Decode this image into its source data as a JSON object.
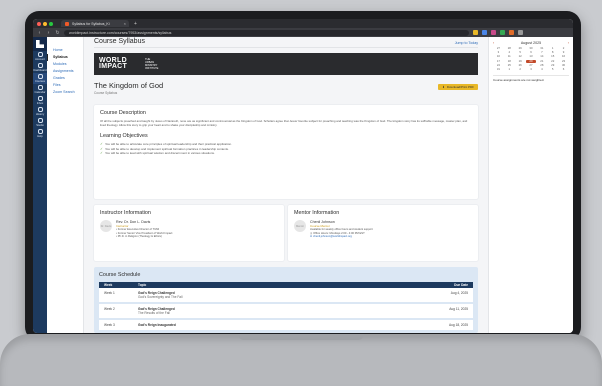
{
  "browser": {
    "tab_title": "Syllabus for Syllabus_Ki",
    "url": "worldimpact.instructure.com/courses/7953/assignments/syllabus"
  },
  "rail": [
    "Account",
    "Dashboard",
    "Courses",
    "Calendar",
    "Inbox",
    "History",
    "Studio",
    "Help"
  ],
  "course_nav": [
    "Home",
    "Syllabus",
    "Modules",
    "Assignments",
    "Grades",
    "Files",
    "Zoom Search"
  ],
  "header": {
    "title": "Course Syllabus",
    "student_view": "Jump to Today"
  },
  "banner": {
    "logo_line1": "WORLD",
    "logo_line2": "IMPACT",
    "sub1": "THE",
    "sub2": "URBAN",
    "sub3": "MINISTRY",
    "sub4": "INSTITUTE"
  },
  "course": {
    "title": "The Kingdom of God",
    "subtitle": "Course Syllabus",
    "pdf_button": "Download/Print PDF"
  },
  "description": {
    "heading": "Course Description",
    "text": "Of all the subjects preached and taught by Jesus of Nazareth, none are as significant and controversial as the Kingdom of God. Scholars agree that Jesus' favorite subject for preaching and teaching was the Kingdom of God. The kingdom story has its suffrable message, master plan, and lived theology. Allow this story to grip your heart and to shake your discipleship and ministry."
  },
  "objectives": {
    "heading": "Learning Objectives",
    "items": [
      "You will be able to articulate core principles of spiritual leadership and their practical application.",
      "You will be able to develop and implement spiritual formation practices in leadership contexts.",
      "You will be able to lead with spiritual wisdom and discernment in various situations."
    ]
  },
  "instructor": {
    "heading": "Instructor Information",
    "avatar": "Dr. Davis",
    "name": "Rev. Dr. Don L. Davis",
    "role": "Instructor",
    "bullets": [
      "Former Executive Director of TUMI",
      "Former Senior Vice President of World Impact",
      "Ph.D. in Religion (Theology & Ethics)"
    ]
  },
  "mentor": {
    "heading": "Mentor Information",
    "avatar": "Mentor",
    "name": "Chenil Johnson",
    "role": "Course Mentor",
    "note": "Available for weekly office hours and student support",
    "hours": "Office Hours: Mondays 2:00 - 4:00 PM EST",
    "email": "chenil.johnson@worldimpact.org"
  },
  "schedule": {
    "heading": "Course Schedule",
    "columns": [
      "Week",
      "Topic",
      "Due Date"
    ],
    "rows": [
      {
        "week": "Week 1",
        "title": "God's Reign Challenged",
        "sub": "God's Sovereignty and The Fall",
        "due": "Aug 4, 2025"
      },
      {
        "week": "Week 2",
        "title": "God's Reign Challenged",
        "sub": "The Results of the Fall",
        "due": "Aug 11, 2025"
      },
      {
        "week": "Week 3",
        "title": "God's Reign Inaugurated",
        "sub": "",
        "due": "Aug 18, 2025"
      }
    ]
  },
  "calendar": {
    "month": "August 2025",
    "days": [
      "27",
      "28",
      "29",
      "30",
      "31",
      "1",
      "2",
      "3",
      "4",
      "5",
      "6",
      "7",
      "8",
      "9",
      "10",
      "11",
      "12",
      "13",
      "14",
      "15",
      "16",
      "17",
      "18",
      "19",
      "20",
      "21",
      "22",
      "23",
      "24",
      "25",
      "26",
      "27",
      "28",
      "29",
      "30",
      "31",
      "1",
      "2",
      "3",
      "4",
      "5",
      "6"
    ],
    "today": "20",
    "note": "Course assignments are not weighted."
  },
  "colors": {
    "rail": "#1d3a5f",
    "accent": "#e8b828",
    "link": "#2d6bb7",
    "schedule_bg": "#dbe7f4"
  }
}
